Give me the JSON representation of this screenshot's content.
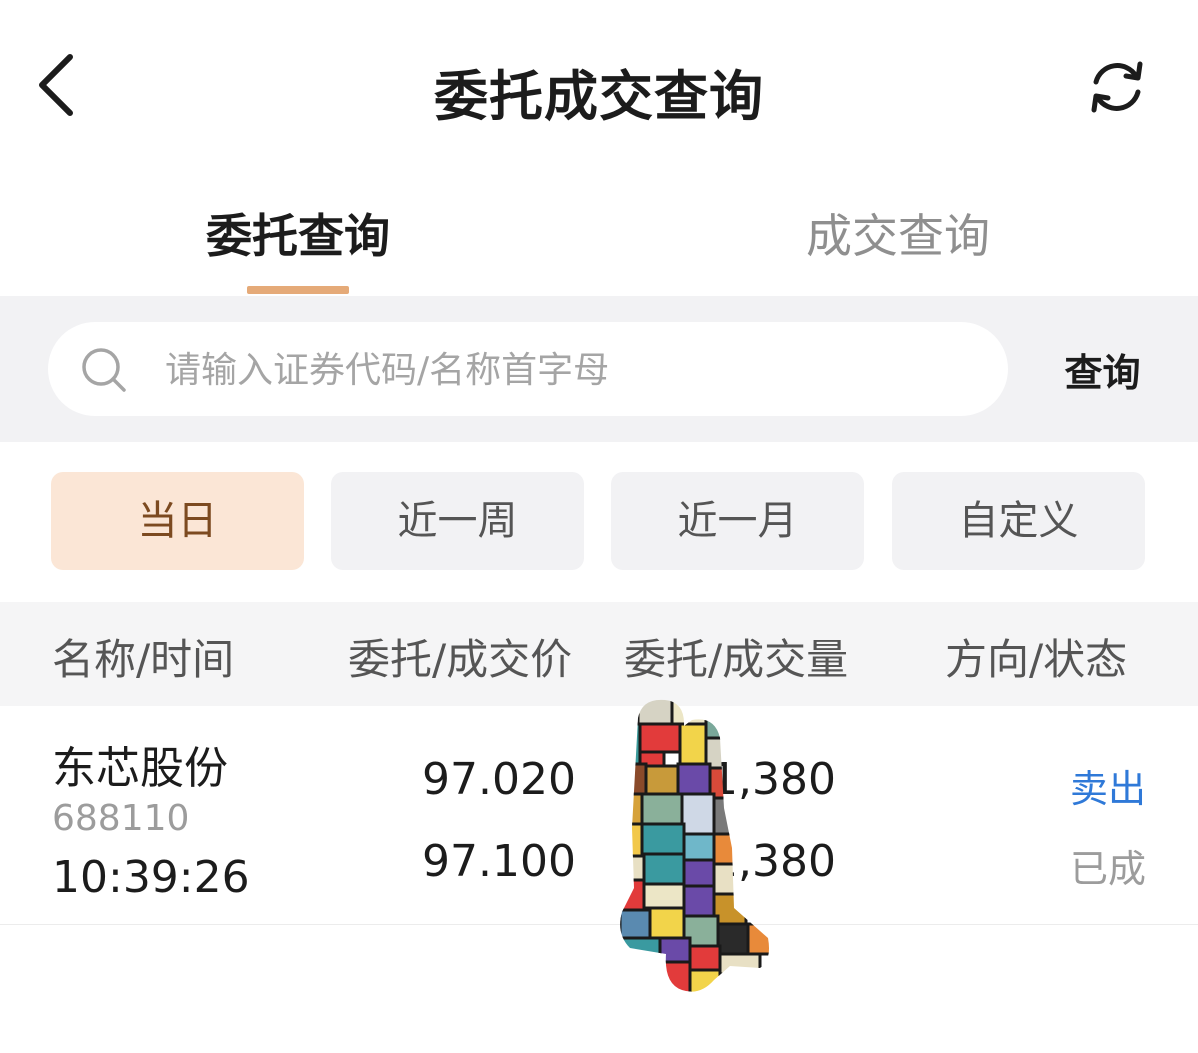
{
  "header": {
    "title": "委托成交查询",
    "back_icon": "chevron-left-icon",
    "refresh_icon": "refresh-icon"
  },
  "tabs": [
    {
      "label": "委托查询",
      "active": true
    },
    {
      "label": "成交查询",
      "active": false
    }
  ],
  "search": {
    "placeholder": "请输入证券代码/名称首字母",
    "value": "",
    "icon": "search-icon",
    "button_label": "查询"
  },
  "filters": [
    {
      "label": "当日",
      "active": true
    },
    {
      "label": "近一周",
      "active": false
    },
    {
      "label": "近一月",
      "active": false
    },
    {
      "label": "自定义",
      "active": false
    }
  ],
  "table": {
    "columns": [
      "名称/时间",
      "委托/成交价",
      "委托/成交量",
      "方向/状态"
    ],
    "rows": [
      {
        "name": "东芯股份",
        "code": "688110",
        "time": "10:39:26",
        "order_price": "97.020",
        "deal_price": "97.100",
        "order_qty": "1,380",
        "deal_qty": "1,380",
        "direction": "卖出",
        "status": "已成"
      }
    ]
  },
  "colors": {
    "accent": "#e5aa78",
    "active_filter_bg": "#fbe6d6",
    "active_filter_text": "#7c4a20",
    "sell_blue": "#2f79d8",
    "panel_bg": "#f2f2f4"
  }
}
